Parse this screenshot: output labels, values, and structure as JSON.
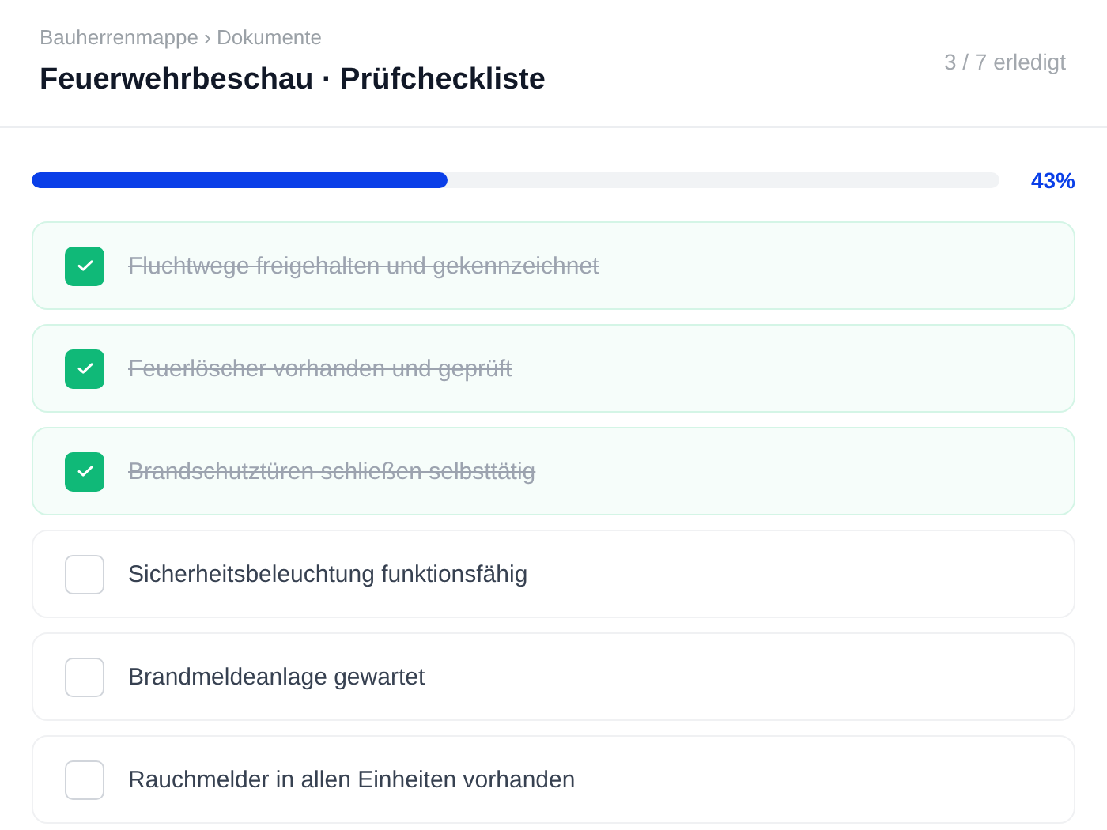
{
  "breadcrumb": "Bauherrenmappe › Dokumente",
  "title": "Feuerwehrbeschau · Prüfcheckliste",
  "counter": "3 / 7 erledigt",
  "progress": {
    "level": 0.43,
    "reading": "43%"
  },
  "items": [
    {
      "label": "Fluchtwege freigehalten und gekennzeichnet",
      "checked": true
    },
    {
      "label": "Feuerlöscher vorhanden und geprüft",
      "checked": true
    },
    {
      "label": "Brandschutztüren schließen selbsttätig",
      "checked": true
    },
    {
      "label": "Sicherheitsbeleuchtung funktionsfähig",
      "checked": false
    },
    {
      "label": "Brandmeldeanlage gewartet",
      "checked": false
    },
    {
      "label": "Rauchmelder in allen Einheiten vorhanden",
      "checked": false
    }
  ]
}
